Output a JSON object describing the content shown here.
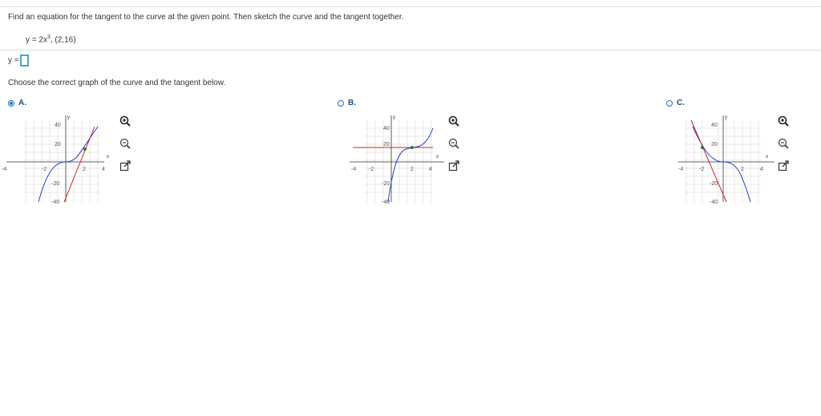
{
  "question": {
    "prompt": "Find an equation for the tangent to the curve at the given point. Then sketch the curve and the tangent together.",
    "equation_prefix": "y = 2x",
    "equation_exponent": "3",
    "point": ", (2,16)"
  },
  "answer": {
    "label": "y =",
    "value": ""
  },
  "choose_prompt": "Choose the correct graph of the curve and the tangent below.",
  "options": [
    {
      "label": "A.",
      "selected": true
    },
    {
      "label": "B.",
      "selected": false
    },
    {
      "label": "C.",
      "selected": false
    }
  ],
  "graph_ticks": {
    "y_labels": [
      "40",
      "20",
      "-20",
      "-40"
    ],
    "x_labels": [
      "-4",
      "-2",
      "2",
      "4"
    ],
    "x_axis_label": "x",
    "y_axis_label": "y"
  },
  "colors": {
    "curve": "#1f3fd6",
    "tangent": "#d42020",
    "point": "#2a7a2a",
    "accent": "#1a73c9"
  },
  "icons": [
    "zoom-in-icon",
    "zoom-out-icon",
    "open-new-window-icon"
  ]
}
